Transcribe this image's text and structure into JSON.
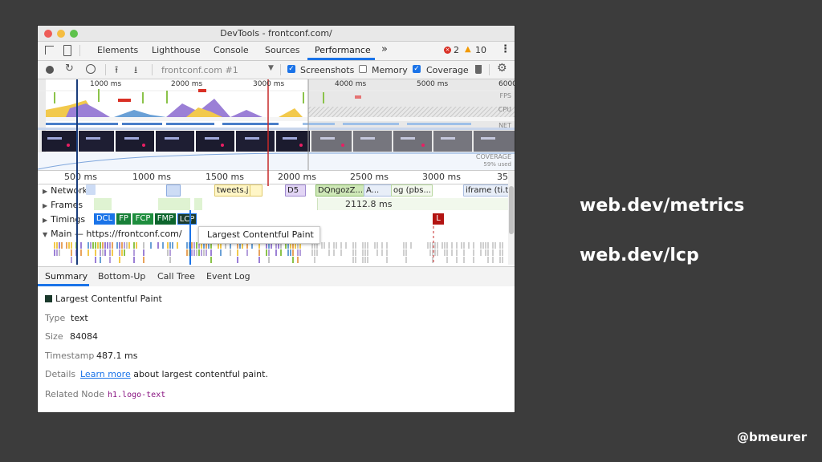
{
  "window": {
    "title": "DevTools - frontconf.com/"
  },
  "tabs": [
    {
      "label": "Elements"
    },
    {
      "label": "Lighthouse"
    },
    {
      "label": "Console"
    },
    {
      "label": "Sources"
    },
    {
      "label": "Performance"
    }
  ],
  "errors_count": "2",
  "warnings_count": "10",
  "toolbar": {
    "profile_select": "frontconf.com #1",
    "screenshots_label": "Screenshots",
    "memory_label": "Memory",
    "coverage_label": "Coverage"
  },
  "overview": {
    "ticks": [
      "1000 ms",
      "2000 ms",
      "3000 ms",
      "4000 ms",
      "5000 ms",
      "6000"
    ],
    "lanes": {
      "fps": "FPS",
      "cpu": "CPU",
      "net": "NET",
      "coverage": "COVERAGE",
      "coverage_used": "59% used"
    }
  },
  "ruler_ticks": [
    "500 ms",
    "1000 ms",
    "1500 ms",
    "2000 ms",
    "2500 ms",
    "3000 ms",
    "35"
  ],
  "tracks": {
    "network": {
      "label": "Network",
      "requests": [
        "tweets.j",
        "D5",
        "DQngozZ...",
        "A...",
        "og (pbs...",
        "iframe (ti.t"
      ]
    },
    "frames": {
      "label": "Frames",
      "duration": "2112.8 ms"
    },
    "timings": {
      "label": "Timings",
      "markers": [
        "DCL",
        "FP",
        "FCP",
        "FMP",
        "LCP",
        "L"
      ]
    },
    "main": {
      "label": "Main — https://frontconf.com/"
    }
  },
  "tooltip": "Largest Contentful Paint",
  "summary_tabs": [
    "Summary",
    "Bottom-Up",
    "Call Tree",
    "Event Log"
  ],
  "summary": {
    "title": "Largest Contentful Paint",
    "type_key": "Type",
    "type_val": "text",
    "size_key": "Size",
    "size_val": "84084",
    "timestamp_key": "Timestamp",
    "timestamp_val": "487.1 ms",
    "details_key": "Details",
    "details_link": "Learn more",
    "details_text": "about largest contentful paint.",
    "node_key": "Related Node",
    "node_val": "h1.logo-text"
  },
  "side": {
    "link1": "web.dev/metrics",
    "link2": "web.dev/lcp",
    "handle": "@bmeurer"
  },
  "colors": {
    "accent": "#1a73e8",
    "dcl": "#1a73e8",
    "fp": "#188038",
    "fcp": "#1e8e3e",
    "fmp": "#0d652d",
    "lcp": "#1b3a2c",
    "load": "#b31412"
  }
}
